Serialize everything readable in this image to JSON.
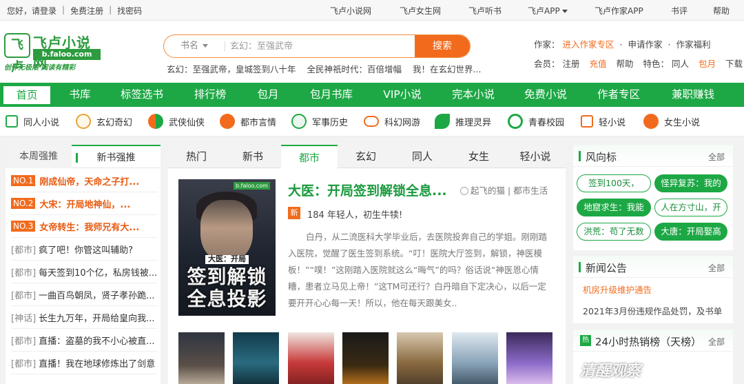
{
  "topbar": {
    "greeting": "您好，请登录",
    "register": "免费注册",
    "find_password": "找密码",
    "links": [
      "飞卢小说网",
      "飞卢女生网",
      "飞卢听书",
      "飞卢APP",
      "飞卢作家APP",
      "书评",
      "帮助"
    ]
  },
  "logo": {
    "mark": "飞卢",
    "name": "飞卢小说网",
    "url": "b.faloo.com",
    "slogan": "创作无极限 阅读有精彩"
  },
  "search": {
    "type": "书名",
    "placeholder": "玄幻：至强武帝",
    "button": "搜索"
  },
  "hotwords": [
    "玄幻：至强武帝，皇城签到八十年",
    "全民神祇时代：百倍增幅",
    "我！在玄幻世界..."
  ],
  "author_links": {
    "label": "作家：",
    "zone": "进入作家专区",
    "apply": "申请作家",
    "welfare": "作家福利"
  },
  "member_links": {
    "label": "会员：",
    "register": "注册",
    "recharge": "充值",
    "help": "帮助",
    "feature_label": "特色：",
    "tongren": "同人",
    "baoyue": "包月",
    "download": "下载"
  },
  "mainnav": [
    "首页",
    "书库",
    "标签选书",
    "排行榜",
    "包月",
    "包月书库",
    "VIP小说",
    "完本小说",
    "免费小说",
    "作者专区",
    "兼职赚钱"
  ],
  "categories": [
    "同人小说",
    "玄幻奇幻",
    "武侠仙侠",
    "都市言情",
    "军事历史",
    "科幻网游",
    "推理灵异",
    "青春校园",
    "轻小说",
    "女生小说"
  ],
  "left_tabs": [
    "本周强推",
    "新书强推"
  ],
  "top_ranks": [
    {
      "no": "NO.1",
      "title": "刚成仙帝，天命之子打..."
    },
    {
      "no": "NO.2",
      "title": "大宋：开局地神仙，..."
    },
    {
      "no": "NO.3",
      "title": "女帝转生：我师兄有大..."
    }
  ],
  "rank_list": [
    {
      "tag": "[都市]",
      "title": "疯了吧！你管这叫辅助?"
    },
    {
      "tag": "[都市]",
      "title": "每天签到10个亿，私房钱被..."
    },
    {
      "tag": "[都市]",
      "title": "一曲百鸟朝凤，贤子孝孙跪..."
    },
    {
      "tag": "[神话]",
      "title": "长生九万年，开局给皇向我..."
    },
    {
      "tag": "[都市]",
      "title": "直播：盗墓的我不小心被直..."
    },
    {
      "tag": "[都市]",
      "title": "直播！我在地球修炼出了剑意"
    }
  ],
  "mid_tabs": [
    "热门",
    "新书",
    "都市",
    "玄幻",
    "同人",
    "女生",
    "轻小说"
  ],
  "feature_book": {
    "cover_badge": "b.faloo.com",
    "cover_small": "大医：开局",
    "cover_big_1": "签到解锁",
    "cover_big_2": "全息投影",
    "title": "大医：开局签到解锁全息...",
    "author": "起飞的猫",
    "genre": "都市生活",
    "new_badge": "新",
    "latest": "184 年轻人，初生牛犊!",
    "desc": "白丹，从二流医科大学毕业后，去医院投奔自己的学姐。刚刚踏入医院，觉醒了医生签到系统。“叮！医院大厅签到，解锁，神医模板！”“噗！”这刚踏入医院就这么“晦气”的吗？俗话说“神医恩心情糟，患者立马见上帝！”这TM可还行？白丹暗自下定决心，以后一定要开开心心每一天！所以，他在每天跟美女.."
  },
  "wind": {
    "title": "风向标",
    "more": "全部",
    "pills": [
      "签到100天，",
      "怪异复苏：我的",
      "地窟求生：我能",
      "人在方寸山，开",
      "洪荒：苟了无数",
      "大唐：开局娶高"
    ]
  },
  "news": {
    "title": "新闻公告",
    "more": "全部",
    "items": [
      "机房升级维护通告",
      "2021年3月份违规作品处罚，及书单"
    ]
  },
  "hot24": {
    "icon": "热",
    "title": "24小时热销榜（天榜）",
    "more": "全部"
  },
  "watermark": "清醒观察"
}
